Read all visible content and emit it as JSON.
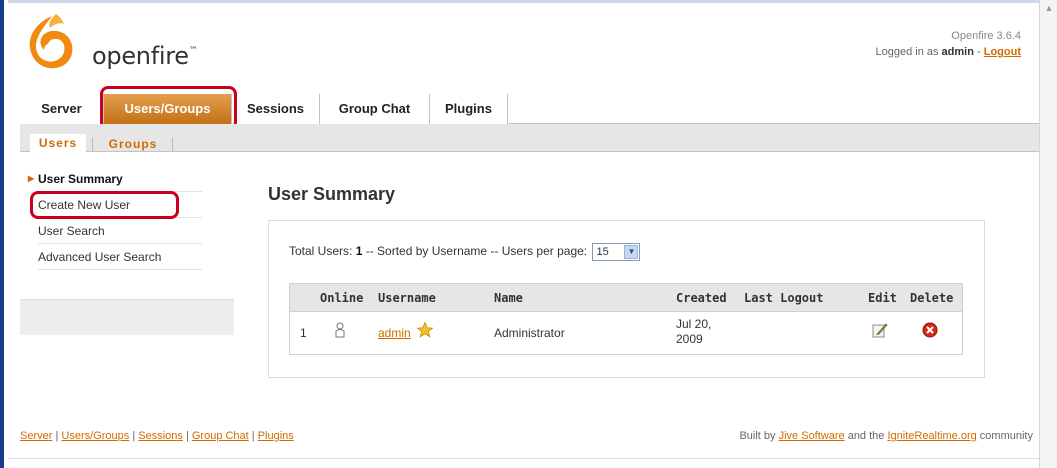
{
  "header": {
    "logo_text": "openfire",
    "logo_tm": "™",
    "version": "Openfire 3.6.4",
    "login_prefix": "Logged in as ",
    "login_user": "admin",
    "login_sep": " - ",
    "logout_label": "Logout"
  },
  "nav": {
    "tabs": [
      {
        "label": "Server"
      },
      {
        "label": "Users/Groups"
      },
      {
        "label": "Sessions"
      },
      {
        "label": "Group Chat"
      },
      {
        "label": "Plugins"
      }
    ],
    "active_index": 1
  },
  "subnav": {
    "tabs": [
      {
        "label": "Users"
      },
      {
        "label": "Groups"
      }
    ],
    "active_index": 0
  },
  "sidebar": {
    "items": [
      {
        "label": "User Summary"
      },
      {
        "label": "Create New User"
      },
      {
        "label": "User Search"
      },
      {
        "label": "Advanced User Search"
      }
    ],
    "current_index": 0
  },
  "main": {
    "title": "User Summary",
    "summary_prefix": "Total Users: ",
    "total_users": "1",
    "summary_middle": " -- Sorted by Username -- Users per page: ",
    "per_page": "15"
  },
  "table": {
    "headers": {
      "online": "Online",
      "username": "Username",
      "name": "Name",
      "created": "Created",
      "last_logout": "Last Logout",
      "edit": "Edit",
      "delete": "Delete"
    },
    "rows": [
      {
        "index": "1",
        "username": "admin",
        "name": "Administrator",
        "created_line1": "Jul 20,",
        "created_line2": "2009",
        "last_logout": ""
      }
    ]
  },
  "footer": {
    "links": [
      "Server",
      "Users/Groups",
      "Sessions",
      "Group Chat",
      "Plugins"
    ],
    "sep": "|",
    "built_by_prefix": "Built by ",
    "jive_link": "Jive Software",
    "built_by_middle": " and the ",
    "ignite_link": "IgniteRealtime.org",
    "built_by_suffix": " community"
  },
  "colors": {
    "accent": "#d06b00",
    "highlight": "#c8001e",
    "active_tab": "#c27016"
  }
}
